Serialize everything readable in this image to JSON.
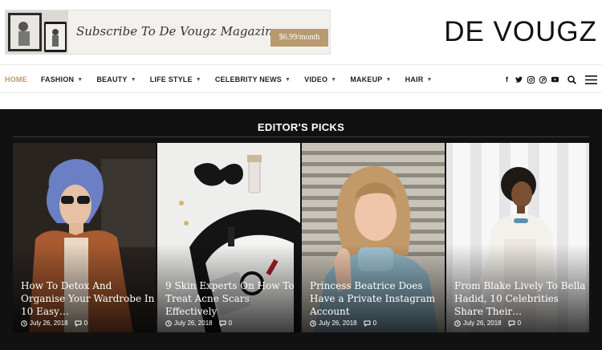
{
  "header": {
    "banner_text": "Subscribe To De Vougz Magazine",
    "banner_price": "$6.99/month",
    "logo": "DE VOUGZ"
  },
  "nav": {
    "items": [
      {
        "label": "Home",
        "active": true,
        "has_caret": false
      },
      {
        "label": "Fashion",
        "has_caret": true
      },
      {
        "label": "Beauty",
        "has_caret": true
      },
      {
        "label": "Life Style",
        "has_caret": true
      },
      {
        "label": "Celebrity News",
        "has_caret": true
      },
      {
        "label": "Video",
        "has_caret": true
      },
      {
        "label": "Makeup",
        "has_caret": true
      },
      {
        "label": "Hair",
        "has_caret": true
      }
    ],
    "social": [
      "f",
      "t",
      "o",
      "p",
      "y"
    ],
    "icons": [
      "facebook-icon",
      "twitter-icon",
      "instagram-icon",
      "pinterest-icon",
      "youtube-icon",
      "search-icon",
      "hamburger-menu-icon"
    ],
    "active_color": "#b89a6e"
  },
  "picks": {
    "title": "EDITOR'S PICKS",
    "cards": [
      {
        "title": "How To Detox And Organise Your Wardrobe In 10 Easy…",
        "date": "July 26, 2018",
        "comments": "0"
      },
      {
        "title": "9 Skin Experts On How To Treat Acne Scars Effectively",
        "date": "July 26, 2018",
        "comments": "0"
      },
      {
        "title": "Princess Beatrice Does Have a Private Instagram Account",
        "date": "July 26, 2018",
        "comments": "0"
      },
      {
        "title": "From Blake Lively To Bella Hadid, 10 Celebrities Share Their…",
        "date": "July 26, 2018",
        "comments": "0"
      }
    ]
  }
}
